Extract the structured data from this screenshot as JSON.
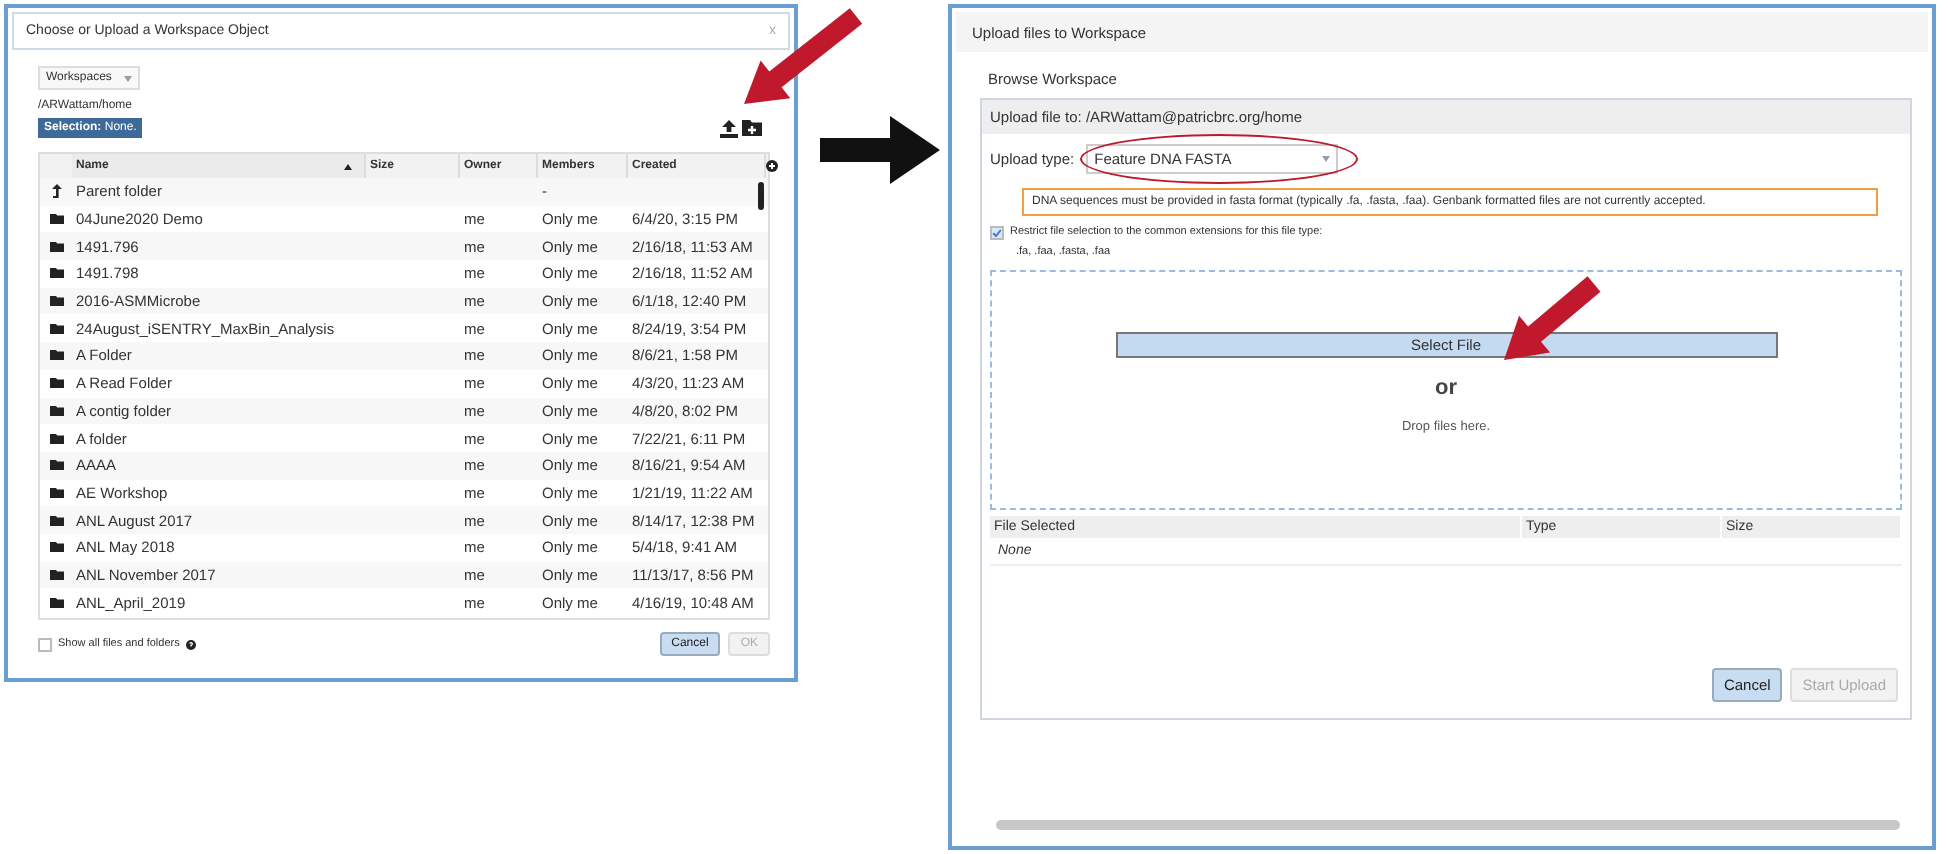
{
  "choose_dialog": {
    "title": "Choose or Upload a Workspace Object",
    "close": "x",
    "workspace_select": "Workspaces",
    "path": "/ARWattam/home",
    "selection": {
      "label": "Selection:",
      "value": "None."
    },
    "columns": [
      {
        "label": "Name",
        "sorted": true
      },
      {
        "label": "Size",
        "sorted": false
      },
      {
        "label": "Owner",
        "sorted": false
      },
      {
        "label": "Members",
        "sorted": false
      },
      {
        "label": "Created",
        "sorted": false
      }
    ],
    "rows": [
      {
        "kind": "parent",
        "name": "Parent folder",
        "members": "-"
      },
      {
        "kind": "folder",
        "name": "04June2020 Demo",
        "owner": "me",
        "members": "Only me",
        "created": "6/4/20, 3:15 PM"
      },
      {
        "kind": "folder",
        "name": "1491.796",
        "owner": "me",
        "members": "Only me",
        "created": "2/16/18, 11:53 AM"
      },
      {
        "kind": "folder",
        "name": "1491.798",
        "owner": "me",
        "members": "Only me",
        "created": "2/16/18, 11:52 AM"
      },
      {
        "kind": "folder",
        "name": "2016-ASMMicrobe",
        "owner": "me",
        "members": "Only me",
        "created": "6/1/18, 12:40 PM"
      },
      {
        "kind": "folder",
        "name": "24August_iSENTRY_MaxBin_Analysis",
        "owner": "me",
        "members": "Only me",
        "created": "8/24/19, 3:54 PM"
      },
      {
        "kind": "folder",
        "name": "A Folder",
        "owner": "me",
        "members": "Only me",
        "created": "8/6/21, 1:58 PM"
      },
      {
        "kind": "folder",
        "name": "A Read Folder",
        "owner": "me",
        "members": "Only me",
        "created": "4/3/20, 11:23 AM"
      },
      {
        "kind": "folder",
        "name": "A contig folder",
        "owner": "me",
        "members": "Only me",
        "created": "4/8/20, 8:02 PM"
      },
      {
        "kind": "folder",
        "name": "A folder",
        "owner": "me",
        "members": "Only me",
        "created": "7/22/21, 6:11 PM"
      },
      {
        "kind": "folder",
        "name": "AAAA",
        "owner": "me",
        "members": "Only me",
        "created": "8/16/21, 9:54 AM"
      },
      {
        "kind": "folder",
        "name": "AE Workshop",
        "owner": "me",
        "members": "Only me",
        "created": "1/21/19, 11:22 AM"
      },
      {
        "kind": "folder",
        "name": "ANL August 2017",
        "owner": "me",
        "members": "Only me",
        "created": "8/14/17, 12:38 PM"
      },
      {
        "kind": "folder",
        "name": "ANL May 2018",
        "owner": "me",
        "members": "Only me",
        "created": "5/4/18, 9:41 AM"
      },
      {
        "kind": "folder",
        "name": "ANL November 2017",
        "owner": "me",
        "members": "Only me",
        "created": "11/13/17, 8:56 PM"
      },
      {
        "kind": "folder",
        "name": "ANL_April_2019",
        "owner": "me",
        "members": "Only me",
        "created": "4/16/19, 10:48 AM"
      }
    ],
    "show_all": {
      "label": "Show all files and folders",
      "checked": false
    },
    "buttons": [
      {
        "label": "Cancel",
        "disabled": false
      },
      {
        "label": "OK",
        "disabled": true
      }
    ]
  },
  "upload_dialog": {
    "title": "Upload files to Workspace",
    "section": "Browse Workspace",
    "destination": "Upload file to: /ARWattam@patricbrc.org/home",
    "upload_type_label": "Upload type:",
    "upload_type": "Feature DNA FASTA",
    "warning": "DNA sequences must be provided in fasta format (typically .fa, .fasta, .faa). Genbank formatted files are not currently accepted.",
    "restrict": {
      "label": "Restrict file selection to the common extensions for this file type:",
      "extensions": ".fa, .faa, .fasta, .faa",
      "checked": true
    },
    "select_button": "Select File",
    "or": "or",
    "drop_hint": "Drop files here.",
    "file_columns": [
      "File Selected",
      "Type",
      "Size"
    ],
    "file_empty": "None",
    "buttons": [
      {
        "label": "Cancel",
        "disabled": false
      },
      {
        "label": "Start Upload",
        "disabled": true
      }
    ]
  }
}
